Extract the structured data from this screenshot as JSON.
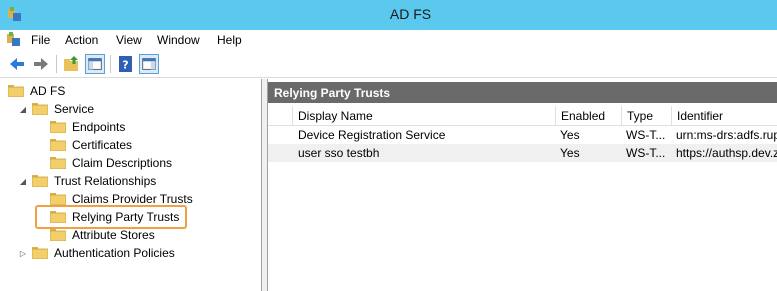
{
  "window": {
    "title": "AD FS"
  },
  "menu": [
    "File",
    "Action",
    "View",
    "Window",
    "Help"
  ],
  "toolbar": {
    "icons": [
      "back-arrow-icon",
      "forward-arrow-icon",
      "up-folder-icon",
      "show-hide-console-tree-icon",
      "help-icon",
      "show-hide-action-pane-icon"
    ]
  },
  "tree": {
    "items": [
      {
        "label": "AD FS",
        "level": 0,
        "expander": ""
      },
      {
        "label": "Service",
        "level": 1,
        "expander": "◢"
      },
      {
        "label": "Endpoints",
        "level": 2,
        "expander": ""
      },
      {
        "label": "Certificates",
        "level": 2,
        "expander": ""
      },
      {
        "label": "Claim Descriptions",
        "level": 2,
        "expander": ""
      },
      {
        "label": "Trust Relationships",
        "level": 1,
        "expander": "◢"
      },
      {
        "label": "Claims Provider Trusts",
        "level": 2,
        "expander": ""
      },
      {
        "label": "Relying Party Trusts",
        "level": 2,
        "expander": "",
        "selected": true
      },
      {
        "label": "Attribute Stores",
        "level": 2,
        "expander": ""
      },
      {
        "label": "Authentication Policies",
        "level": 1,
        "expander": "▷"
      }
    ],
    "highlight_color": "#f0a040"
  },
  "pane": {
    "title": "Relying Party Trusts",
    "columns": [
      "Display Name",
      "Enabled",
      "Type",
      "Identifier"
    ],
    "rows": [
      [
        "Device Registration Service",
        "Yes",
        "WS-T...",
        "urn:ms-drs:adfs.rupind"
      ],
      [
        "user sso testbh",
        "Yes",
        "WS-T...",
        "https://authsp.dev.zp"
      ]
    ]
  },
  "colors": {
    "titlebar": "#5bc8ee",
    "pane_header": "#6a6a6a",
    "folder": "#f2cf6b"
  }
}
